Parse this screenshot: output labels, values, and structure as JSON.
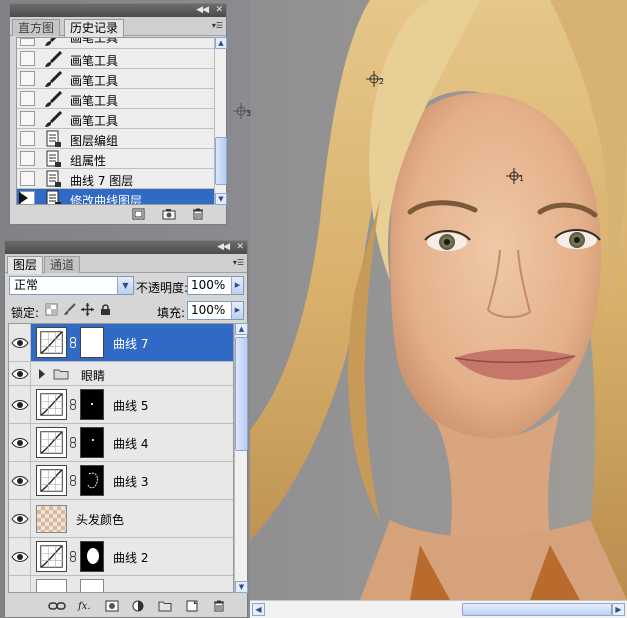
{
  "history_panel": {
    "tabs": [
      {
        "label": "直方图",
        "active": false
      },
      {
        "label": "历史记录",
        "active": true
      }
    ],
    "items": [
      {
        "label": "画笔工具",
        "icon": "brush-icon",
        "selected": false
      },
      {
        "label": "画笔工具",
        "icon": "brush-icon",
        "selected": false
      },
      {
        "label": "画笔工具",
        "icon": "brush-icon",
        "selected": false
      },
      {
        "label": "画笔工具",
        "icon": "brush-icon",
        "selected": false
      },
      {
        "label": "画笔工具",
        "icon": "brush-icon",
        "selected": false
      },
      {
        "label": "图层编组",
        "icon": "history-state-icon",
        "selected": false
      },
      {
        "label": "组属性",
        "icon": "history-state-icon",
        "selected": false
      },
      {
        "label": "曲线 7 图层",
        "icon": "history-state-icon",
        "selected": false
      },
      {
        "label": "修改曲线图层",
        "icon": "history-state-icon",
        "selected": true
      }
    ],
    "bottom_icons": [
      "new-document-icon",
      "snapshot-camera-icon",
      "trash-icon"
    ]
  },
  "layers_panel": {
    "tabs": [
      {
        "label": "图层",
        "active": true
      },
      {
        "label": "通道",
        "active": false
      }
    ],
    "blend_mode": "正常",
    "opacity_label": "不透明度:",
    "opacity_value": "100%",
    "lock_label": "锁定:",
    "fill_label": "填充:",
    "fill_value": "100%",
    "layers": [
      {
        "name": "曲线 7",
        "kind": "curves",
        "mask": "white",
        "selected": true
      },
      {
        "name": "眼睛",
        "kind": "group",
        "selected": false
      },
      {
        "name": "曲线 5",
        "kind": "curves",
        "mask": "black-dot",
        "selected": false
      },
      {
        "name": "曲线 4",
        "kind": "curves",
        "mask": "black-dot",
        "selected": false
      },
      {
        "name": "曲线 3",
        "kind": "curves",
        "mask": "black-outline",
        "selected": false
      },
      {
        "name": "头发颜色",
        "kind": "fill",
        "selected": false
      },
      {
        "name": "曲线 2",
        "kind": "curves",
        "mask": "black-blob",
        "selected": false
      }
    ],
    "bottom_icons": [
      "link-icon",
      "fx-icon",
      "add-mask-icon",
      "adjustment-icon",
      "group-folder-icon",
      "new-layer-icon",
      "trash-icon"
    ]
  },
  "canvas": {
    "color_samplers": [
      "1",
      "2",
      "3"
    ]
  },
  "colors": {
    "selection": "#316ac5",
    "panel_bg": "#d6d6d6",
    "canvas_bg": "#8e8e90"
  }
}
